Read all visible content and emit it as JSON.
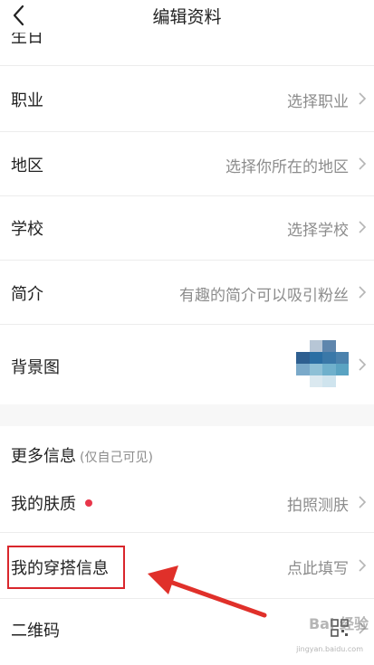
{
  "header": {
    "title": "编辑资料"
  },
  "peek_row": {
    "label": "生日"
  },
  "profile_rows": [
    {
      "label": "职业",
      "value": "选择职业"
    },
    {
      "label": "地区",
      "value": "选择你所在的地区"
    },
    {
      "label": "学校",
      "value": "选择学校"
    },
    {
      "label": "简介",
      "value": "有趣的简介可以吸引粉丝"
    }
  ],
  "background_row": {
    "label": "背景图",
    "thumbnail_colors": [
      "#ffffff",
      "#b7c6d6",
      "#5f86ad",
      "#ffffff",
      "#2e5f90",
      "#2a6ea3",
      "#3a78a8",
      "#4b82ad",
      "#7aa9c9",
      "#8ec0d6",
      "#6fb0cc",
      "#5aa3c2",
      "#ffffff",
      "#dbe9f0",
      "#cfe4ee",
      "#ffffff"
    ]
  },
  "more_info": {
    "title": "更多信息",
    "subtitle": "(仅自己可见)"
  },
  "more_rows": [
    {
      "label": "我的肤质",
      "value": "拍照测肤",
      "has_dot": true
    },
    {
      "label": "我的穿搭信息",
      "value": "点此填写",
      "has_dot": false
    },
    {
      "label": "二维码",
      "value": "",
      "has_dot": false
    }
  ],
  "watermark": {
    "text": "Bai 经验",
    "sub": "jingyan.baidu.com"
  },
  "colors": {
    "accent_red": "#d9262c",
    "dot_red": "#e8364a",
    "secondary_text": "#8c8c8c",
    "divider": "#ececec"
  }
}
